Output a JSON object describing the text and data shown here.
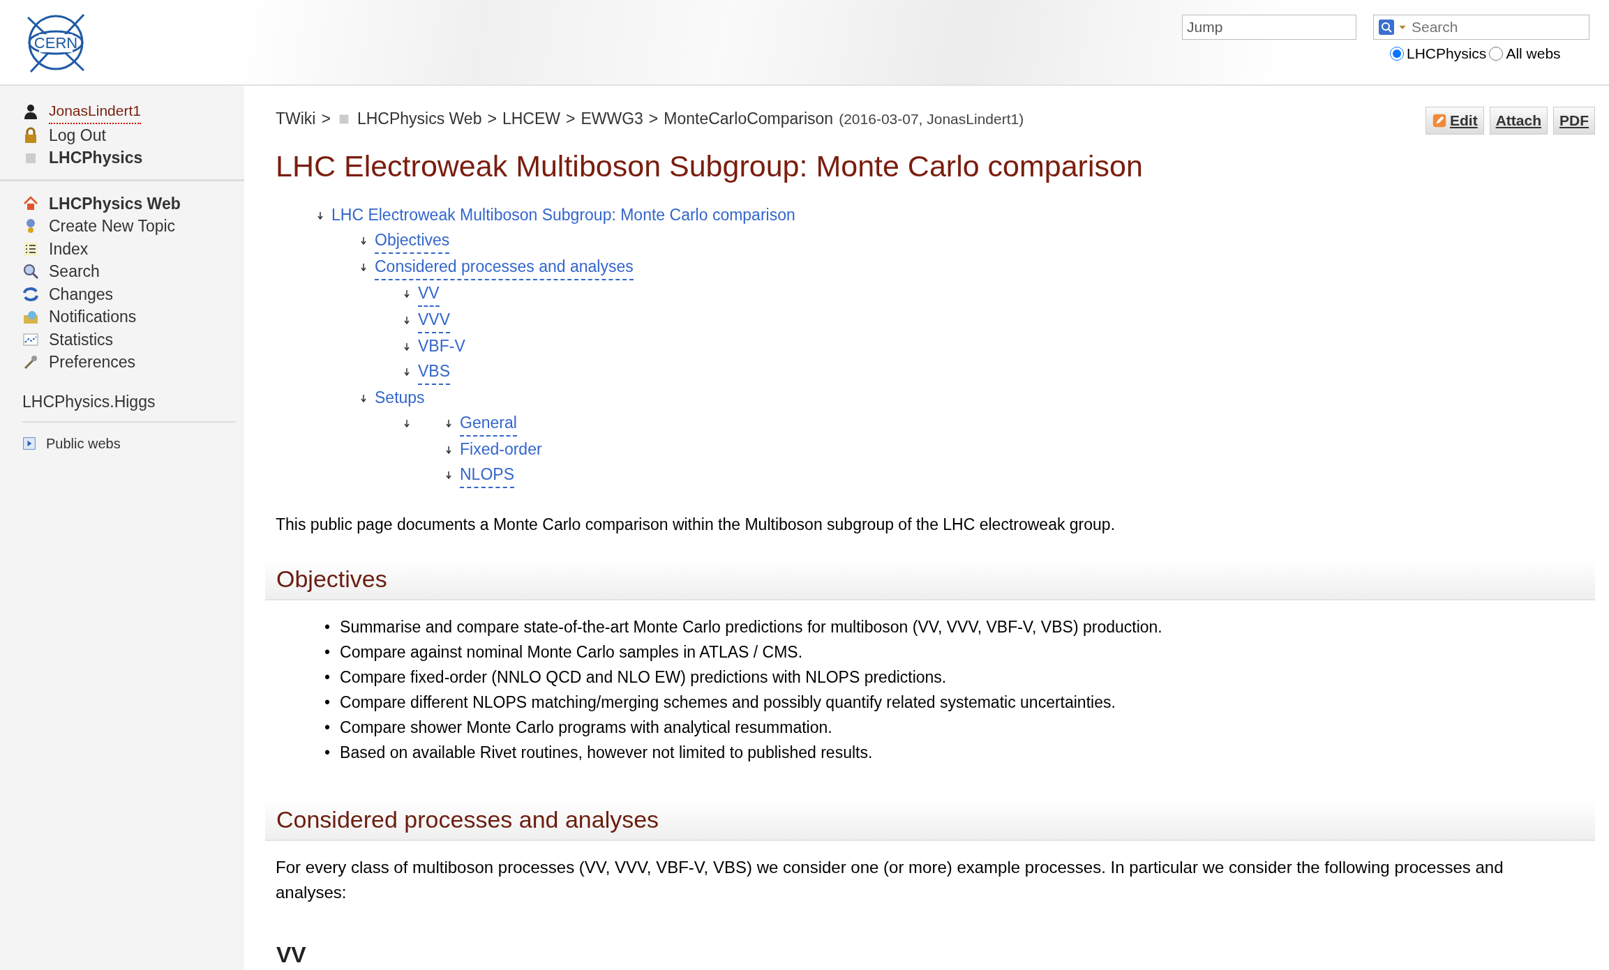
{
  "header": {
    "logo_text": "CERN",
    "jump": {
      "placeholder": "Jump"
    },
    "search": {
      "placeholder": "Search"
    },
    "scope": [
      {
        "label": "LHCPhysics",
        "selected": true
      },
      {
        "label": "All webs",
        "selected": false
      }
    ]
  },
  "sidebar": {
    "user_items": [
      {
        "label": "JonasLindert1",
        "kind": "user"
      },
      {
        "label": "Log Out",
        "kind": "logout"
      },
      {
        "label": "LHCPhysics",
        "kind": "web"
      }
    ],
    "web_items": [
      {
        "label": "LHCPhysics Web",
        "kind": "home"
      },
      {
        "label": "Create New Topic",
        "kind": "create"
      },
      {
        "label": "Index",
        "kind": "index"
      },
      {
        "label": "Search",
        "kind": "search"
      },
      {
        "label": "Changes",
        "kind": "changes"
      },
      {
        "label": "Notifications",
        "kind": "notify"
      },
      {
        "label": "Statistics",
        "kind": "stats"
      },
      {
        "label": "Preferences",
        "kind": "prefs"
      }
    ],
    "other_web": "LHCPhysics.Higgs",
    "public_webs": "Public webs"
  },
  "breadcrumb": {
    "separator": ">",
    "items": [
      {
        "label": "TWiki",
        "web_icon": false
      },
      {
        "label": "LHCPhysics Web",
        "web_icon": true
      },
      {
        "label": "LHCEW",
        "web_icon": false
      },
      {
        "label": "EWWG3",
        "web_icon": false
      },
      {
        "label": "MonteCarloComparison",
        "web_icon": false
      }
    ],
    "revision": "(2016-03-07, JonasLindert1)"
  },
  "actions": [
    {
      "label": "Edit",
      "icon": true
    },
    {
      "label": "Attach",
      "icon": false
    },
    {
      "label": "PDF",
      "icon": false
    }
  ],
  "title": "LHC Electroweak Multiboson Subgroup: Monte Carlo comparison",
  "toc": [
    {
      "label": "LHC Electroweak Multiboson Subgroup: Monte Carlo comparison",
      "underlined": false,
      "children": [
        {
          "label": "Objectives",
          "underlined": true
        },
        {
          "label": "Considered processes and analyses",
          "underlined": true,
          "children": [
            {
              "label": "VV",
              "underlined": true
            },
            {
              "label": "VVV",
              "underlined": true
            },
            {
              "label": "VBF-V",
              "underlined": false
            },
            {
              "label": "VBS",
              "underlined": true
            }
          ]
        },
        {
          "label": "Setups",
          "underlined": false,
          "children": [
            {
              "children": [
                {
                  "label": "General",
                  "underlined": true
                },
                {
                  "label": "Fixed-order",
                  "underlined": false
                },
                {
                  "label": "NLOPS",
                  "underlined": true
                }
              ]
            }
          ]
        }
      ]
    }
  ],
  "intro": "This public page documents a Monte Carlo comparison within the Multiboson subgroup of the LHC electroweak group.",
  "sections": [
    {
      "heading": "Objectives",
      "kind": "h2",
      "marker": "•",
      "bullets": [
        "Summarise and compare state-of-the-art Monte Carlo predictions for multiboson (VV, VVV, VBF-V, VBS) production.",
        "Compare against nominal Monte Carlo samples in ATLAS / CMS.",
        "Compare fixed-order (NNLO QCD and NLO EW) predictions with NLOPS predictions.",
        "Compare different NLOPS matching/merging schemes and possibly quantify related systematic uncertainties.",
        "Compare shower Monte Carlo programs with analytical resummation.",
        "Based on available Rivet routines, however not limited to published results."
      ]
    },
    {
      "heading": "Considered processes and analyses",
      "kind": "h2",
      "text": "For every class of multiboson processes (VV, VVV, VBF-V, VBS) we consider one (or more) example processes. In particular we consider the following processes and analyses:"
    },
    {
      "heading": "VV",
      "kind": "h3"
    }
  ]
}
